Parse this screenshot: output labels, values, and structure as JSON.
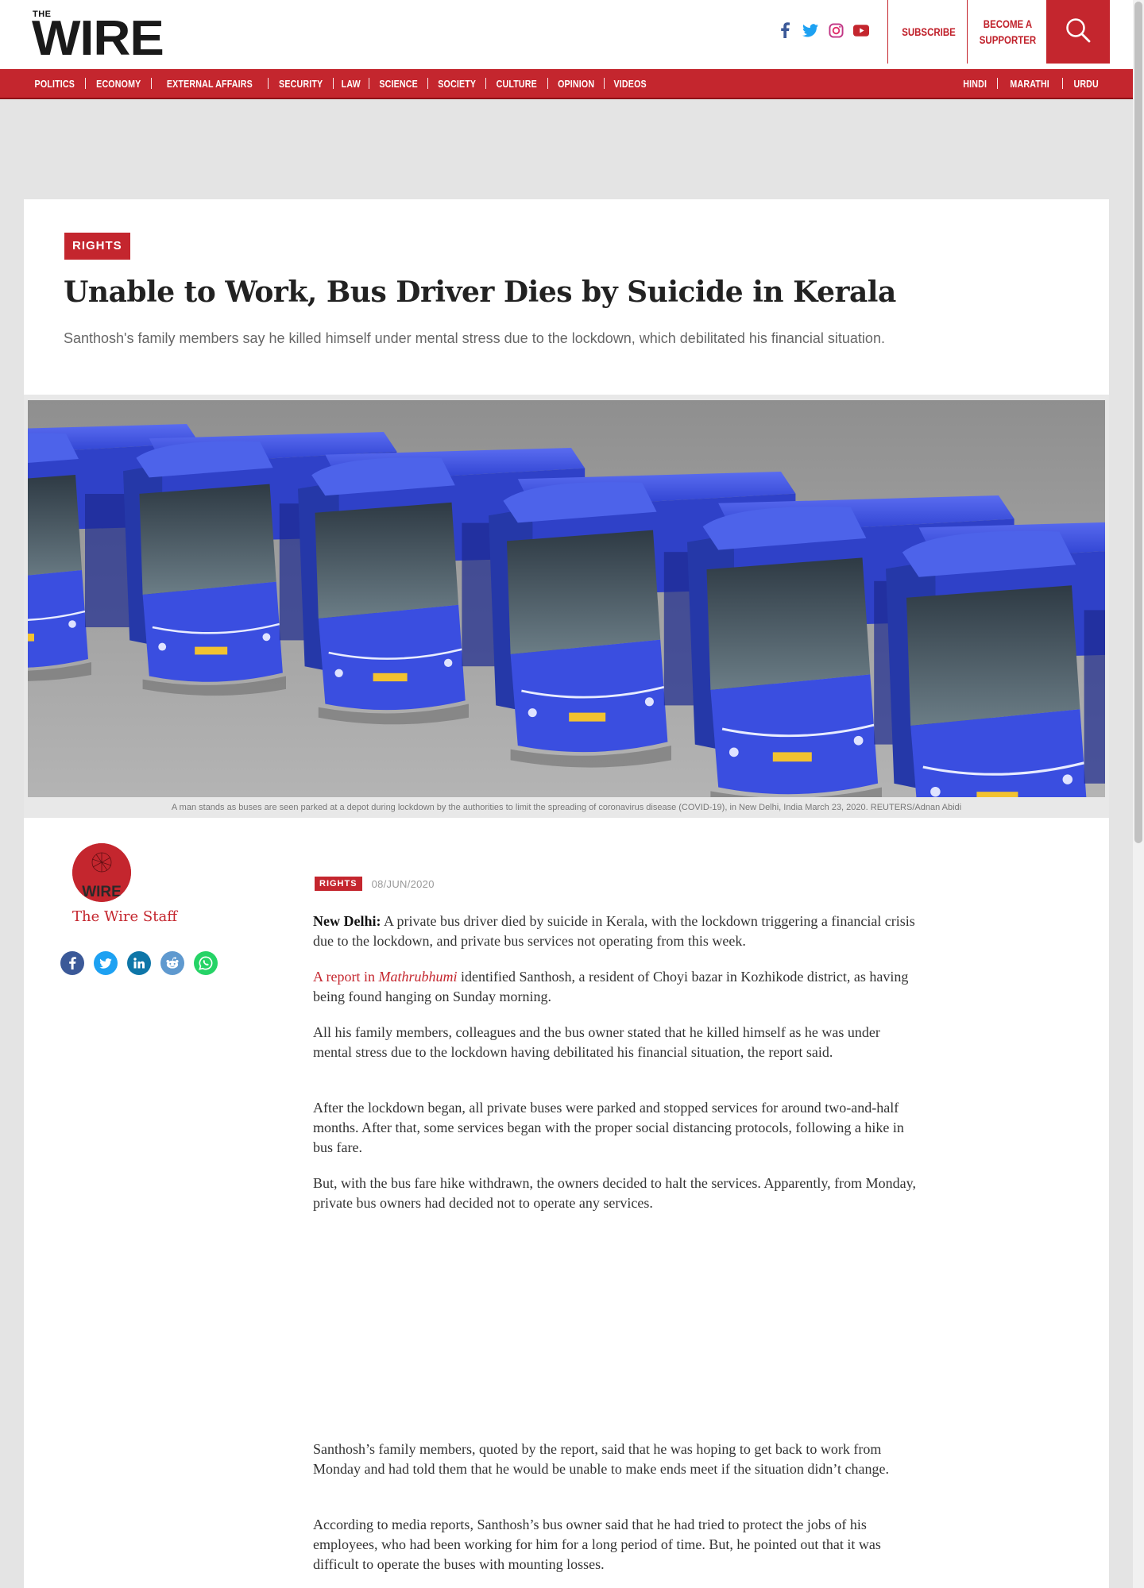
{
  "site": {
    "logo_top": "THE",
    "logo_main": "WIRE"
  },
  "header": {
    "social_icons": [
      "facebook-icon",
      "twitter-icon",
      "instagram-icon",
      "youtube-icon"
    ],
    "subscribe_label": "SUBSCRIBE",
    "supporter_line1": "BECOME A",
    "supporter_line2": "SUPPORTER",
    "accent_color": "#c4262e"
  },
  "nav": {
    "left": [
      "POLITICS",
      "ECONOMY",
      "EXTERNAL AFFAIRS",
      "SECURITY",
      "LAW",
      "SCIENCE",
      "SOCIETY",
      "CULTURE",
      "OPINION",
      "VIDEOS"
    ],
    "right": [
      "HINDI",
      "MARATHI",
      "URDU"
    ]
  },
  "article": {
    "category": "RIGHTS",
    "title": "Unable to Work, Bus Driver Dies by Suicide in Kerala",
    "subtitle": "Santhosh's family members say he killed himself under mental stress due to the lockdown, which debilitated his financial situation.",
    "image_caption": "A man stands as buses are seen parked at a depot during lockdown by the authorities to limit the spreading of coronavirus disease (COVID-19), in New Delhi, India March 23, 2020. REUTERS/Adnan Abidi",
    "author": "The Wire Staff",
    "avatar_text": "WIRE",
    "date": "08/JUN/2020",
    "meta_category": "RIGHTS",
    "share_icons": [
      "facebook-share-icon",
      "twitter-share-icon",
      "linkedin-share-icon",
      "reddit-share-icon",
      "whatsapp-share-icon"
    ],
    "dateline": "New Delhi:",
    "p1": " A private bus driver died by suicide in Kerala, with the lockdown triggering a financial crisis due to the lockdown, and private bus services not operating from this week.",
    "p2_link_prefix": "A report in ",
    "p2_link_italic": "Mathrubhumi",
    "p2_rest": " identified Santhosh, a resident of Choyi bazar in Kozhikode district, as having being found hanging on Sunday morning.",
    "p3": "All his family members, colleagues and the bus owner stated that he killed himself as he was under mental stress due to the lockdown having debilitated his financial situation, the report said.",
    "p4": "After the lockdown began, all private buses were parked and stopped services for around two-and-half months. After that, some services began with the proper social distancing protocols, following a hike in bus fare.",
    "p5": "But, with the bus fare hike withdrawn, the owners decided to halt the services. Apparently, from Monday, private bus owners had decided not to operate any services.",
    "p6": "Santhosh’s family members, quoted by the report, said that he was hoping to get back to work from Monday and had told them that he would be unable to make ends meet if the situation didn’t change.",
    "p7": "According to media reports, Santhosh’s bus owner said that he had tried to protect the jobs of his employees, who had been working for him for a long period of time. But, he pointed out that it was difficult to operate the buses with mounting losses."
  }
}
